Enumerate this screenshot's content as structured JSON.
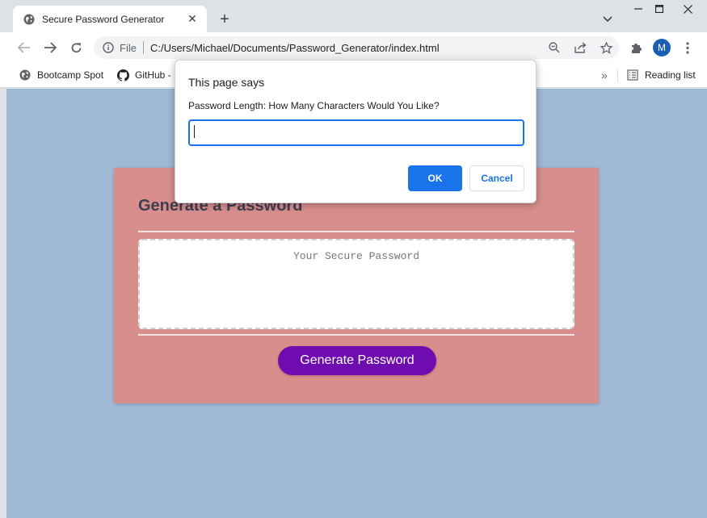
{
  "browser": {
    "tab": {
      "title": "Secure Password Generator",
      "icon": "globe-icon"
    },
    "address": {
      "scheme": "File",
      "url": "C:/Users/Michael/Documents/Password_Generator/index.html"
    },
    "profile_initial": "M",
    "bookmarks": [
      {
        "label": "Bootcamp Spot",
        "icon": "globe-icon"
      },
      {
        "label": "GitHub -",
        "icon": "github-icon"
      }
    ],
    "reading_list": "Reading list"
  },
  "page": {
    "title": "Generate a Password",
    "password_placeholder": "Your Secure Password",
    "generate_label": "Generate Password"
  },
  "dialog": {
    "title": "This page says",
    "message": "Password Length: How Many Characters Would You Like?",
    "input_value": "",
    "ok_label": "OK",
    "cancel_label": "Cancel"
  },
  "colors": {
    "page_background": "#a0b9d6",
    "card": "#d98e8e",
    "button": "#6f0cb0",
    "dialog_accent": "#1a73e8"
  }
}
